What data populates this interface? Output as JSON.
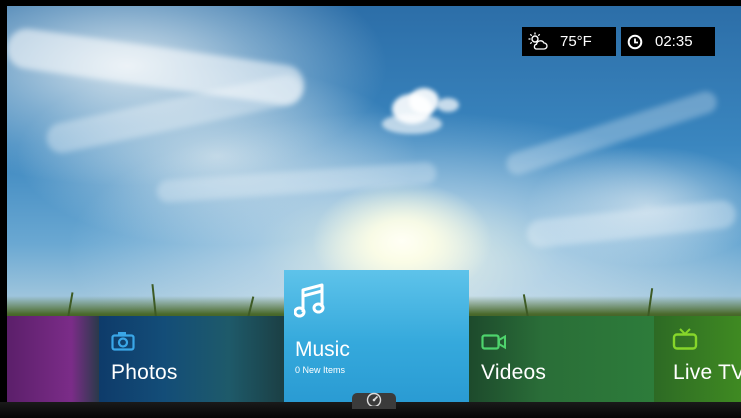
{
  "status": {
    "weather_icon": "partly-cloudy-sun-icon",
    "temperature": "75°F",
    "clock_icon": "clock-icon",
    "time": "02:35"
  },
  "menu": {
    "items": [
      {
        "label": "",
        "icon": "none",
        "color": "#7a2a86"
      },
      {
        "label": "Photos",
        "icon": "camera-icon",
        "color": "#2a8fd8"
      },
      {
        "label": "Music",
        "sublabel": "0 New Items",
        "icon": "music-note-icon",
        "color": "#3aaadc",
        "selected": true
      },
      {
        "label": "Videos",
        "icon": "video-camera-icon",
        "color": "#4ec06a"
      },
      {
        "label": "Live TV",
        "icon": "tv-icon",
        "color": "#7ad12f"
      }
    ]
  },
  "bottom": {
    "handle_icon": "dashboard-gauge-icon"
  }
}
